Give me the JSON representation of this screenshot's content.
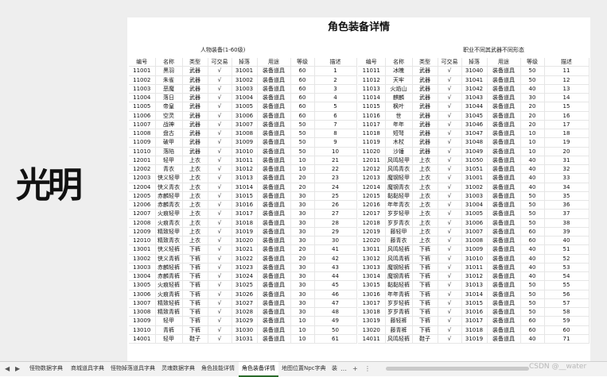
{
  "sheet": {
    "title": "角色装备详情",
    "left_label": "人物装备(1-60级)",
    "right_label": "职业不同其武器不同形态",
    "headers": [
      "编号",
      "名称",
      "类型",
      "可交易",
      "掉落",
      "用途",
      "等级",
      "描述"
    ],
    "left_rows": [
      [
        "11001",
        "黑羽",
        "武器",
        "√",
        "31001",
        "装备道具",
        "60",
        "1"
      ],
      [
        "11002",
        "朱雀",
        "武器",
        "√",
        "31002",
        "装备道具",
        "60",
        "2"
      ],
      [
        "11003",
        "恶魔",
        "武器",
        "√",
        "31003",
        "装备道具",
        "60",
        "3"
      ],
      [
        "11004",
        "落日",
        "武器",
        "√",
        "31004",
        "装备道具",
        "60",
        "4"
      ],
      [
        "11005",
        "帝皇",
        "武器",
        "√",
        "31005",
        "装备道具",
        "60",
        "5"
      ],
      [
        "11006",
        "空灵",
        "武器",
        "√",
        "31006",
        "装备道具",
        "60",
        "6"
      ],
      [
        "11007",
        "战神",
        "武器",
        "√",
        "31007",
        "装备道具",
        "50",
        "7"
      ],
      [
        "11008",
        "盘古",
        "武器",
        "√",
        "31008",
        "装备道具",
        "50",
        "8"
      ],
      [
        "11009",
        "破甲",
        "武器",
        "√",
        "31009",
        "装备道具",
        "50",
        "9"
      ],
      [
        "11010",
        "落陷",
        "武器",
        "√",
        "31010",
        "装备道具",
        "50",
        "10"
      ],
      [
        "12001",
        "轻甲",
        "上衣",
        "√",
        "31011",
        "装备道具",
        "10",
        "21"
      ],
      [
        "12002",
        "青衣",
        "上衣",
        "√",
        "31012",
        "装备道具",
        "10",
        "22"
      ],
      [
        "12003",
        "侠义轻甲",
        "上衣",
        "√",
        "31013",
        "装备道具",
        "20",
        "23"
      ],
      [
        "12004",
        "侠义青衣",
        "上衣",
        "√",
        "31014",
        "装备道具",
        "20",
        "24"
      ],
      [
        "12005",
        "赤麟轻甲",
        "上衣",
        "√",
        "31015",
        "装备道具",
        "30",
        "25"
      ],
      [
        "12006",
        "赤麟青衣",
        "上衣",
        "√",
        "31016",
        "装备道具",
        "30",
        "26"
      ],
      [
        "12007",
        "火痕轻甲",
        "上衣",
        "√",
        "31017",
        "装备道具",
        "30",
        "27"
      ],
      [
        "12008",
        "火痕青衣",
        "上衣",
        "√",
        "31018",
        "装备道具",
        "30",
        "28"
      ],
      [
        "12009",
        "精致轻甲",
        "上衣",
        "√",
        "31019",
        "装备道具",
        "30",
        "29"
      ],
      [
        "12010",
        "精致青衣",
        "上衣",
        "√",
        "31020",
        "装备道具",
        "30",
        "30"
      ],
      [
        "13001",
        "侠义轻裤",
        "下裤",
        "√",
        "31021",
        "装备道具",
        "20",
        "41"
      ],
      [
        "13002",
        "侠义青裤",
        "下裤",
        "√",
        "31022",
        "装备道具",
        "20",
        "42"
      ],
      [
        "13003",
        "赤麟轻裤",
        "下裤",
        "√",
        "31023",
        "装备道具",
        "30",
        "43"
      ],
      [
        "13004",
        "赤麟青裤",
        "下裤",
        "√",
        "31024",
        "装备道具",
        "30",
        "44"
      ],
      [
        "13005",
        "火痕轻裤",
        "下裤",
        "√",
        "31025",
        "装备道具",
        "30",
        "45"
      ],
      [
        "13006",
        "火痕青裤",
        "下裤",
        "√",
        "31026",
        "装备道具",
        "30",
        "46"
      ],
      [
        "13007",
        "精致轻裤",
        "下裤",
        "√",
        "31027",
        "装备道具",
        "30",
        "47"
      ],
      [
        "13008",
        "精致青裤",
        "下裤",
        "√",
        "31028",
        "装备道具",
        "30",
        "48"
      ],
      [
        "13009",
        "轻甲",
        "下裤",
        "√",
        "31029",
        "装备道具",
        "10",
        "49"
      ],
      [
        "13010",
        "青裤",
        "下裤",
        "√",
        "31030",
        "装备道具",
        "10",
        "50"
      ],
      [
        "14001",
        "轻甲",
        "鞋子",
        "√",
        "31031",
        "装备道具",
        "10",
        "61"
      ]
    ],
    "right_rows": [
      [
        "11011",
        "冰魄",
        "武器",
        "√",
        "31040",
        "装备道具",
        "50",
        "11"
      ],
      [
        "11012",
        "天牢",
        "武器",
        "√",
        "31041",
        "装备道具",
        "50",
        "12"
      ],
      [
        "11013",
        "火焰山",
        "武器",
        "√",
        "31042",
        "装备道具",
        "40",
        "13"
      ],
      [
        "11014",
        "麒麟",
        "武器",
        "√",
        "31043",
        "装备道具",
        "30",
        "14"
      ],
      [
        "11015",
        "枫叶",
        "武器",
        "√",
        "31044",
        "装备道具",
        "20",
        "15"
      ],
      [
        "11016",
        "世",
        "武器",
        "√",
        "31045",
        "装备道具",
        "20",
        "16"
      ],
      [
        "11017",
        "年年",
        "武器",
        "√",
        "31046",
        "装备道具",
        "20",
        "17"
      ],
      [
        "11018",
        "短弩",
        "武器",
        "√",
        "31047",
        "装备道具",
        "10",
        "18"
      ],
      [
        "11019",
        "木杖",
        "武器",
        "√",
        "31048",
        "装备道具",
        "10",
        "19"
      ],
      [
        "11020",
        "沙锤",
        "武器",
        "√",
        "31049",
        "装备道具",
        "10",
        "20"
      ],
      [
        "12011",
        "风鸣轻甲",
        "上衣",
        "√",
        "31050",
        "装备道具",
        "40",
        "31"
      ],
      [
        "12012",
        "风鸣青衣",
        "上衣",
        "√",
        "31051",
        "装备道具",
        "40",
        "32"
      ],
      [
        "12013",
        "魔钢轻甲",
        "上衣",
        "√",
        "31001",
        "装备道具",
        "40",
        "33"
      ],
      [
        "12014",
        "魔钢青衣",
        "上衣",
        "√",
        "31002",
        "装备道具",
        "40",
        "34"
      ],
      [
        "12015",
        "黏黏轻甲",
        "上衣",
        "√",
        "31003",
        "装备道具",
        "50",
        "35"
      ],
      [
        "12016",
        "年年青衣",
        "上衣",
        "√",
        "31004",
        "装备道具",
        "50",
        "36"
      ],
      [
        "12017",
        "岁岁轻甲",
        "上衣",
        "√",
        "31005",
        "装备道具",
        "50",
        "37"
      ],
      [
        "12018",
        "岁岁青衣",
        "上衣",
        "√",
        "31006",
        "装备道具",
        "50",
        "38"
      ],
      [
        "12019",
        "藤轻甲",
        "上衣",
        "√",
        "31007",
        "装备道具",
        "60",
        "39"
      ],
      [
        "12020",
        "藤青衣",
        "上衣",
        "√",
        "31008",
        "装备道具",
        "60",
        "40"
      ],
      [
        "13011",
        "风鸣轻裤",
        "下裤",
        "√",
        "31009",
        "装备道具",
        "40",
        "51"
      ],
      [
        "13012",
        "风鸣青裤",
        "下裤",
        "√",
        "31010",
        "装备道具",
        "40",
        "52"
      ],
      [
        "13013",
        "魔钢轻裤",
        "下裤",
        "√",
        "31011",
        "装备道具",
        "40",
        "53"
      ],
      [
        "13014",
        "魔钢青裤",
        "下裤",
        "√",
        "31012",
        "装备道具",
        "40",
        "54"
      ],
      [
        "13015",
        "黏黏轻裤",
        "下裤",
        "√",
        "31013",
        "装备道具",
        "50",
        "55"
      ],
      [
        "13016",
        "年年青裤",
        "下裤",
        "√",
        "31014",
        "装备道具",
        "50",
        "56"
      ],
      [
        "13017",
        "岁岁轻裤",
        "下裤",
        "√",
        "31015",
        "装备道具",
        "50",
        "57"
      ],
      [
        "13018",
        "岁岁青裤",
        "下裤",
        "√",
        "31016",
        "装备道具",
        "50",
        "58"
      ],
      [
        "13019",
        "藤轻裤",
        "下裤",
        "√",
        "31017",
        "装备道具",
        "60",
        "59"
      ],
      [
        "13020",
        "藤青裤",
        "下裤",
        "√",
        "31018",
        "装备道具",
        "60",
        "60"
      ],
      [
        "14011",
        "风鸣轻裤",
        "鞋子",
        "√",
        "31019",
        "装备道具",
        "40",
        "71"
      ]
    ]
  },
  "logo": {
    "text": "光明"
  },
  "tabs": {
    "items": [
      "怪物数据字典",
      "商城道具字典",
      "怪物掉落道具字典",
      "灵魂数据字典",
      "角色技能详情",
      "角色装备详情",
      "地图位置Npc字典",
      "装"
    ],
    "active_index": 5,
    "nav_prev": "…",
    "nav_add": "+",
    "nav_more": "⋮",
    "nav_left": "◀",
    "nav_right": "▶"
  },
  "watermark": "CSDN @__water"
}
